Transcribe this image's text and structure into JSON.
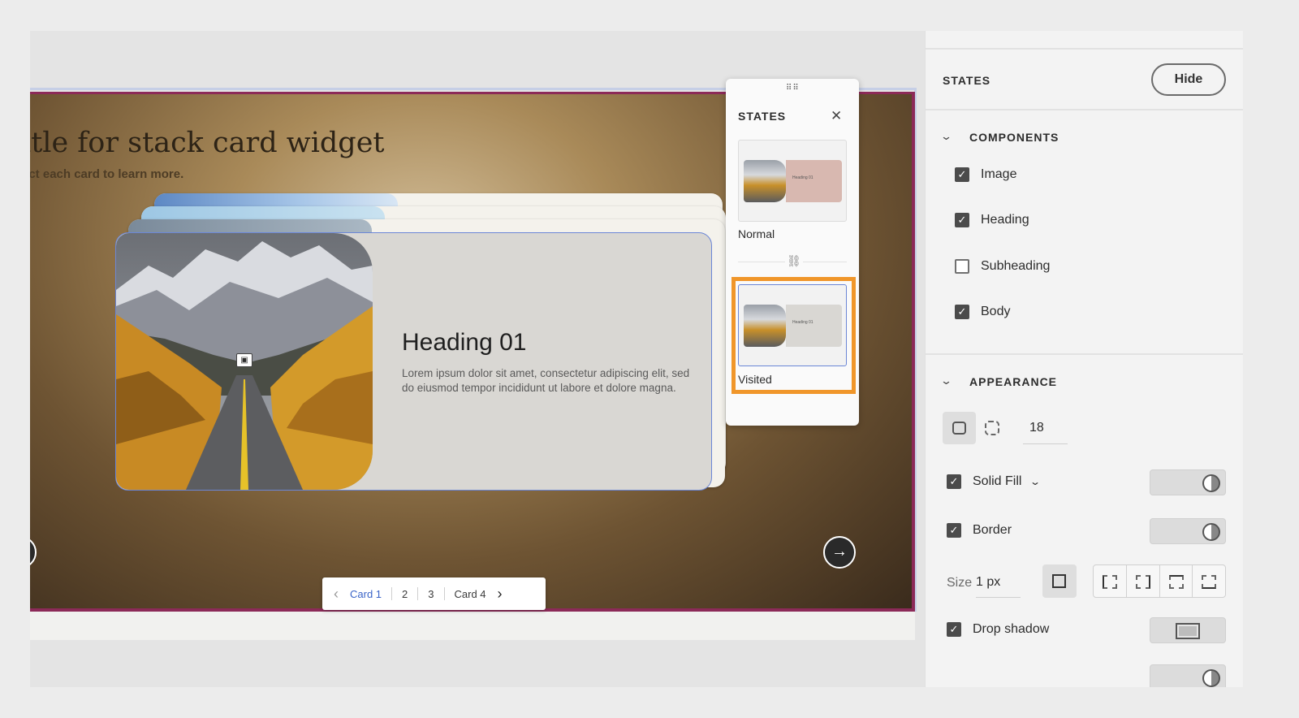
{
  "slide": {
    "title": "itle for stack card widget",
    "subtitle": "ect each card to learn more."
  },
  "card": {
    "heading": "Heading 01",
    "body": "Lorem ipsum dolor sit amet, consectetur adipiscing elit, sed do eiusmod tempor incididunt ut labore et dolore magna."
  },
  "pager": {
    "items": [
      "Card 1",
      "2",
      "3",
      "Card 4"
    ],
    "active_index": 0
  },
  "states_popup": {
    "title": "STATES",
    "states": [
      {
        "label": "Normal",
        "thumb_heading": "Heading 01",
        "fill": "#d8b8b0"
      },
      {
        "label": "Visited",
        "thumb_heading": "Heading 01",
        "fill": "#d9d7d3"
      }
    ],
    "selected": "Visited"
  },
  "panel": {
    "title": "STATES",
    "hide_label": "Hide",
    "components": {
      "title": "COMPONENTS",
      "items": [
        {
          "label": "Image",
          "checked": true
        },
        {
          "label": "Heading",
          "checked": true
        },
        {
          "label": "Subheading",
          "checked": false
        },
        {
          "label": "Body",
          "checked": true
        }
      ]
    },
    "appearance": {
      "title": "APPEARANCE",
      "corner_radius": "18",
      "solid_fill_label": "Solid Fill",
      "solid_fill_checked": true,
      "border_label": "Border",
      "border_checked": true,
      "size_label": "Size",
      "size_value": "1 px",
      "drop_shadow_label": "Drop shadow",
      "drop_shadow_checked": true
    }
  },
  "colors": {
    "accent_blue": "#3a64c8",
    "highlight_orange": "#f0962a",
    "slide_border": "#8c2a58"
  }
}
